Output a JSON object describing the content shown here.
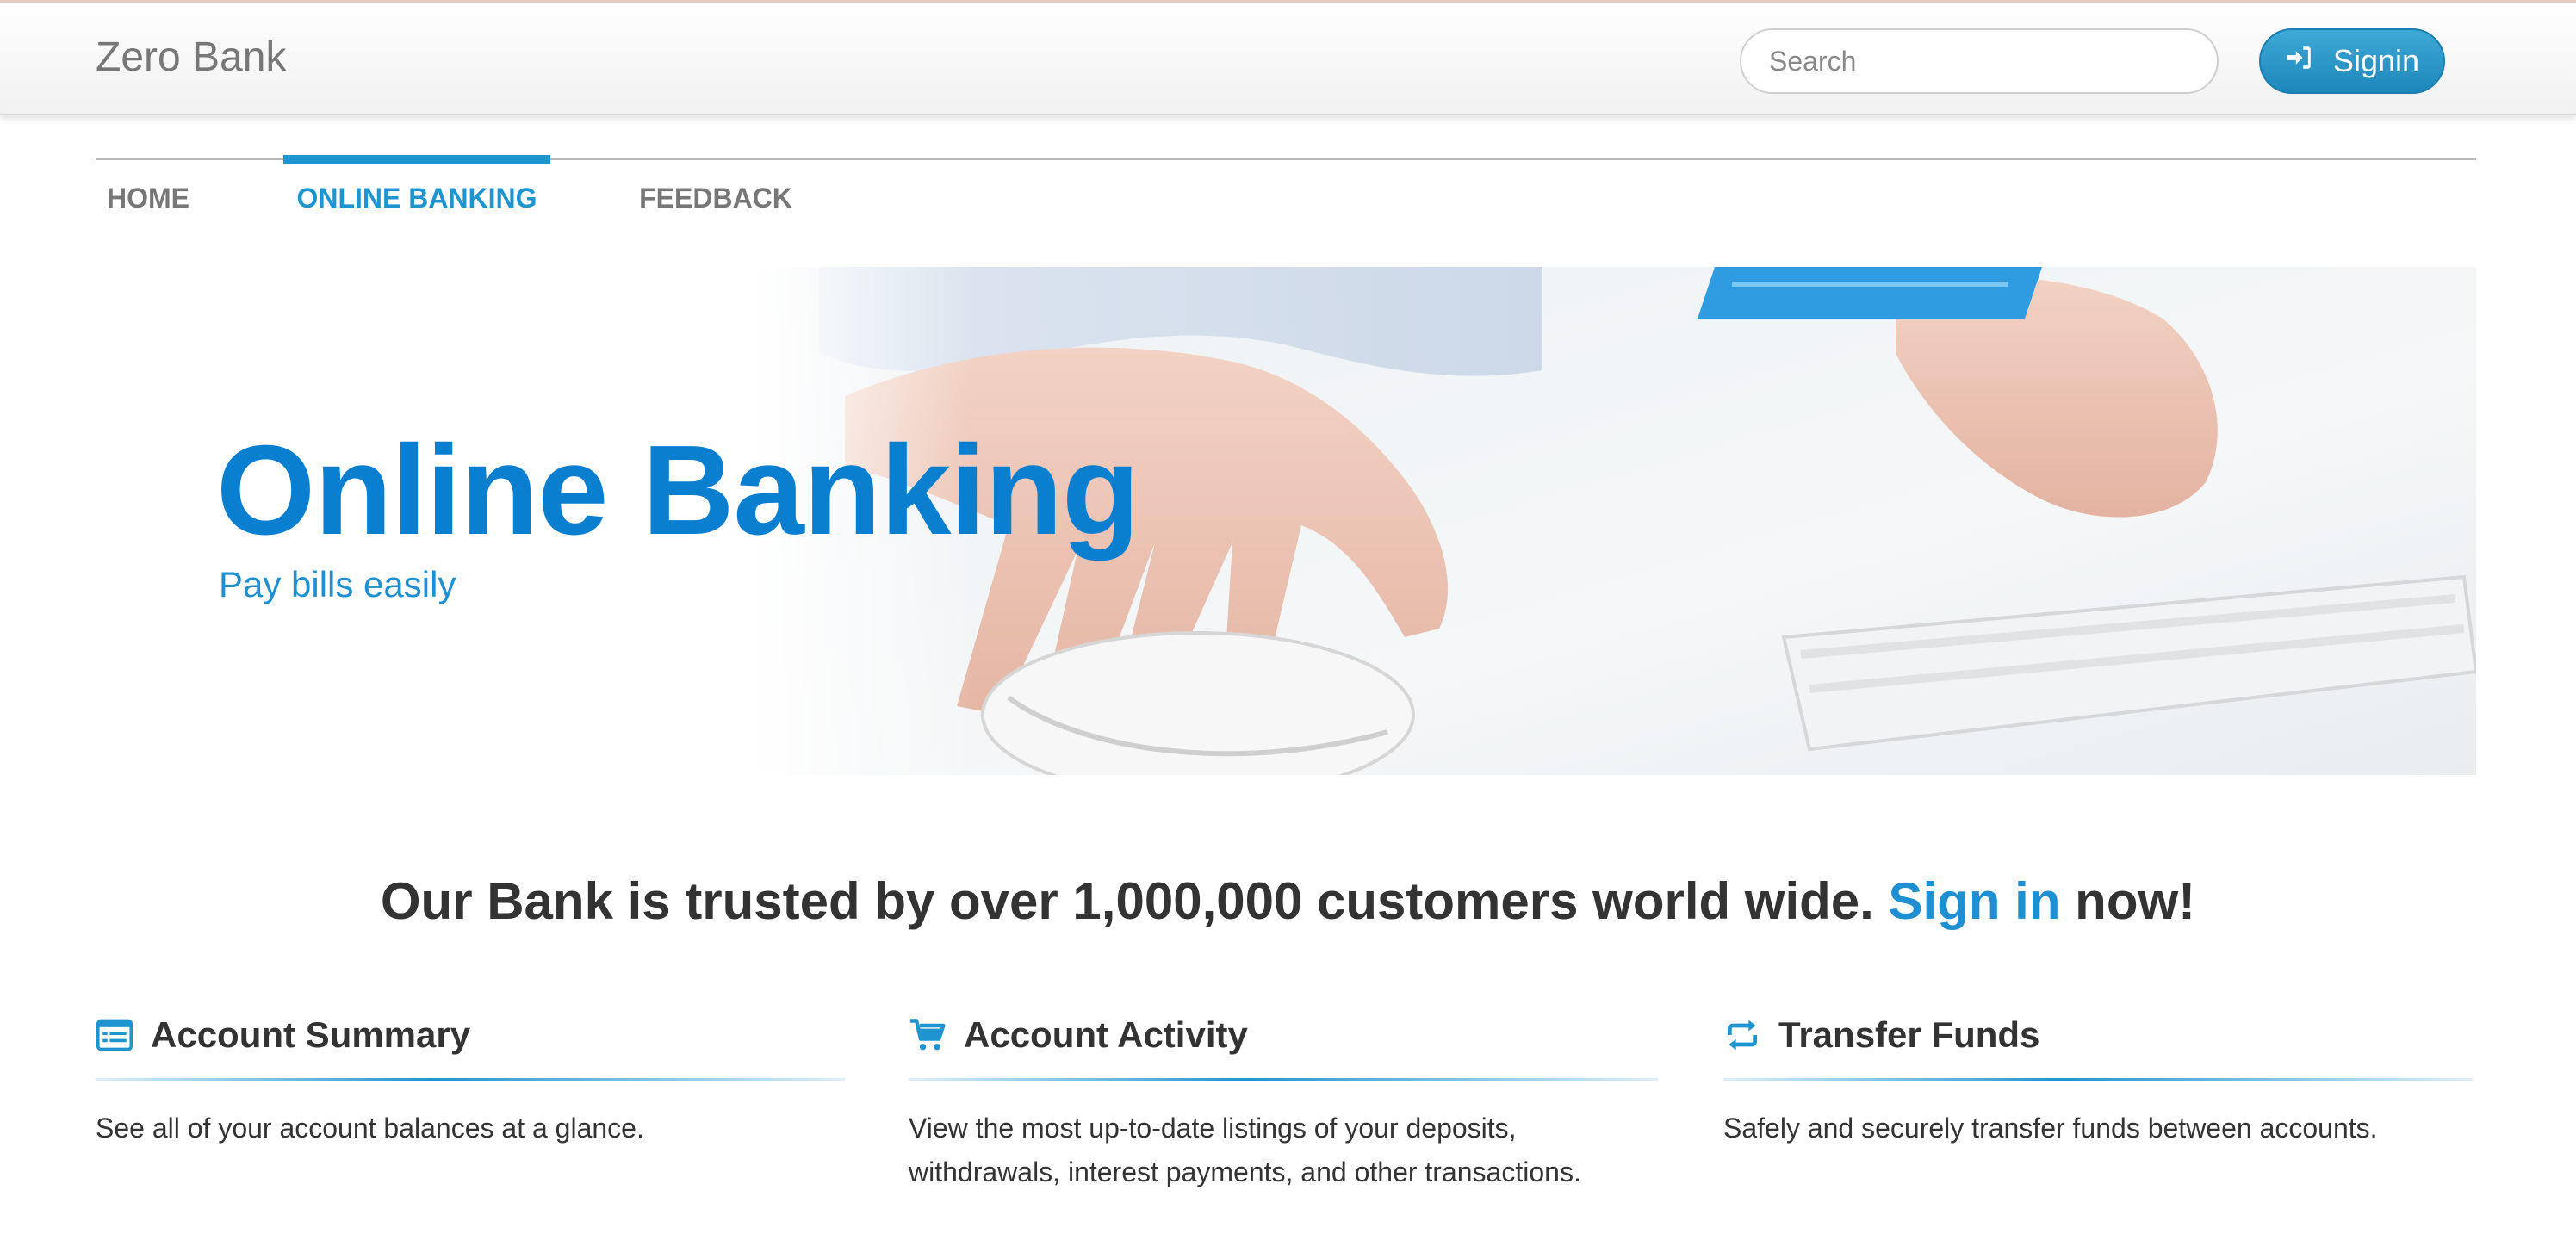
{
  "header": {
    "brand": "Zero Bank",
    "search_placeholder": "Search",
    "signin_label": "Signin"
  },
  "nav": {
    "tabs": [
      {
        "label": "HOME",
        "active": false
      },
      {
        "label": "ONLINE BANKING",
        "active": true
      },
      {
        "label": "FEEDBACK",
        "active": false
      }
    ]
  },
  "hero": {
    "title": "Online Banking",
    "subtitle": "Pay bills easily"
  },
  "trust": {
    "text_before": "Our Bank is trusted by over 1,000,000 customers world wide. ",
    "link": "Sign in",
    "text_after": " now!"
  },
  "features": [
    {
      "icon": "list-icon",
      "title": "Account Summary",
      "text": "See all of your account balances at a glance."
    },
    {
      "icon": "cart-icon",
      "title": "Account Activity",
      "text": "View the most up-to-date listings of your deposits, withdrawals, interest payments, and other transactions."
    },
    {
      "icon": "transfer-icon",
      "title": "Transfer Funds",
      "text": "Safely and securely transfer funds between accounts."
    }
  ],
  "colors": {
    "accent": "#1e95cf",
    "hero_title": "#0a7fd0",
    "button_blue": "#2a98c9"
  }
}
